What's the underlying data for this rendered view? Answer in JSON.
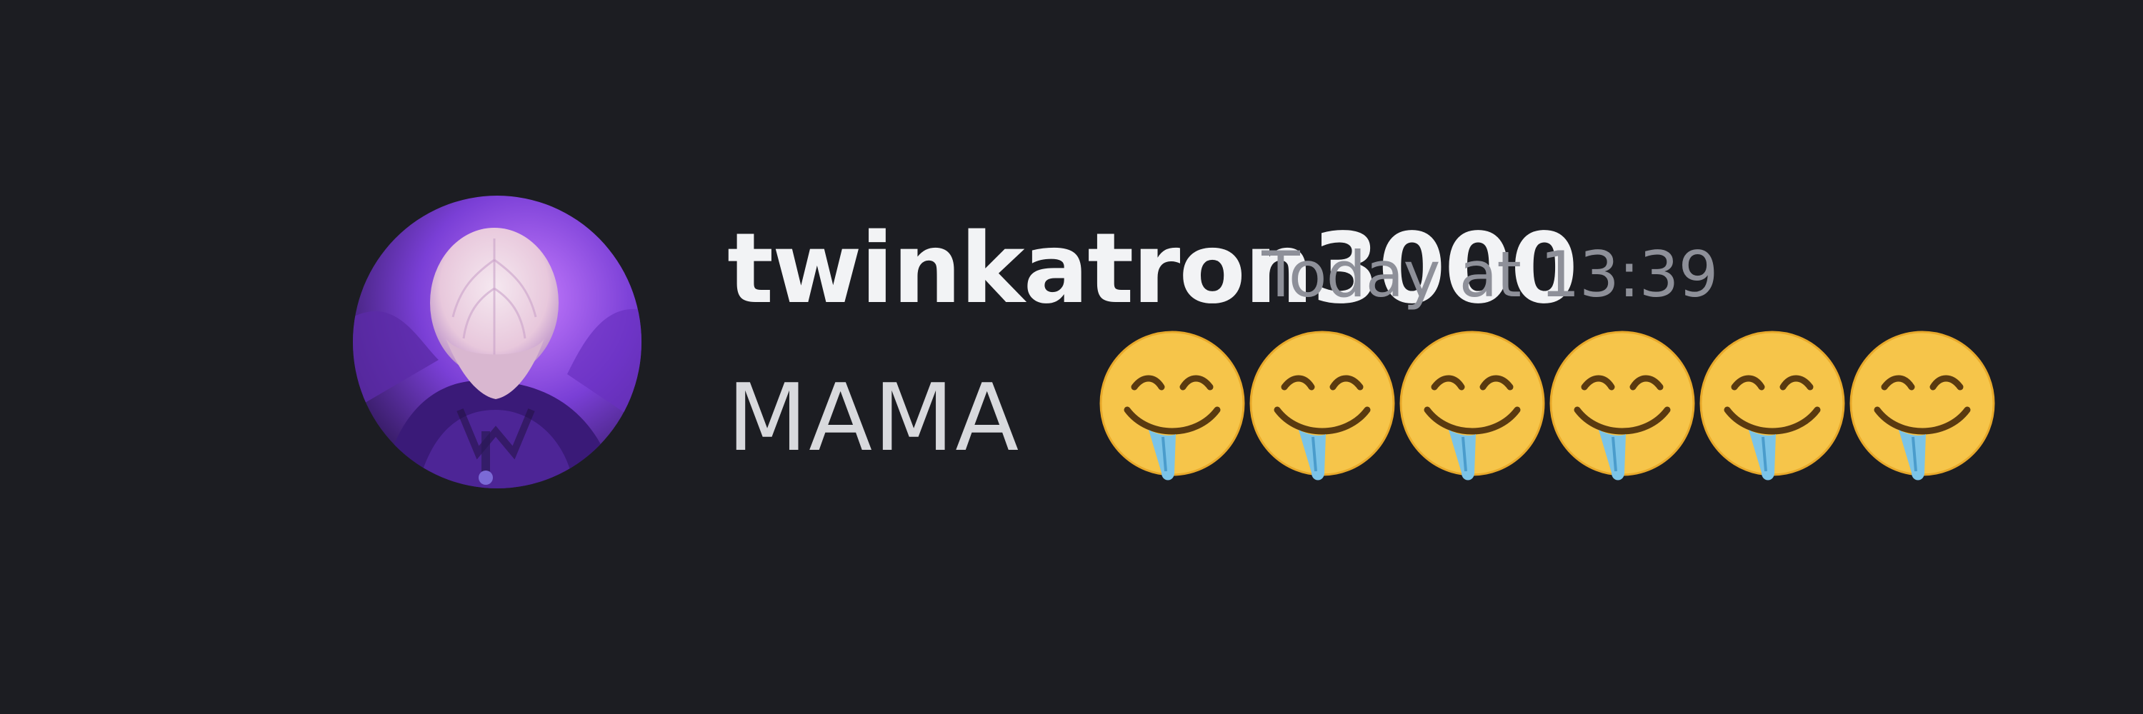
{
  "message": {
    "author": "twinkatron3000",
    "timestamp": "Today at 13:39",
    "text": "MAMA",
    "reactions_inline": [
      {
        "icon": "drooling-face-icon"
      },
      {
        "icon": "drooling-face-icon"
      },
      {
        "icon": "drooling-face-icon"
      },
      {
        "icon": "drooling-face-icon"
      },
      {
        "icon": "drooling-face-icon"
      },
      {
        "icon": "drooling-face-icon"
      }
    ]
  },
  "colors": {
    "background": "#1c1d22",
    "username": "#f2f3f5",
    "timestamp": "#8e9099",
    "message_text": "#d8d9dd",
    "emoji_face": "#f6c54a",
    "emoji_drool": "#7cc4e8"
  }
}
